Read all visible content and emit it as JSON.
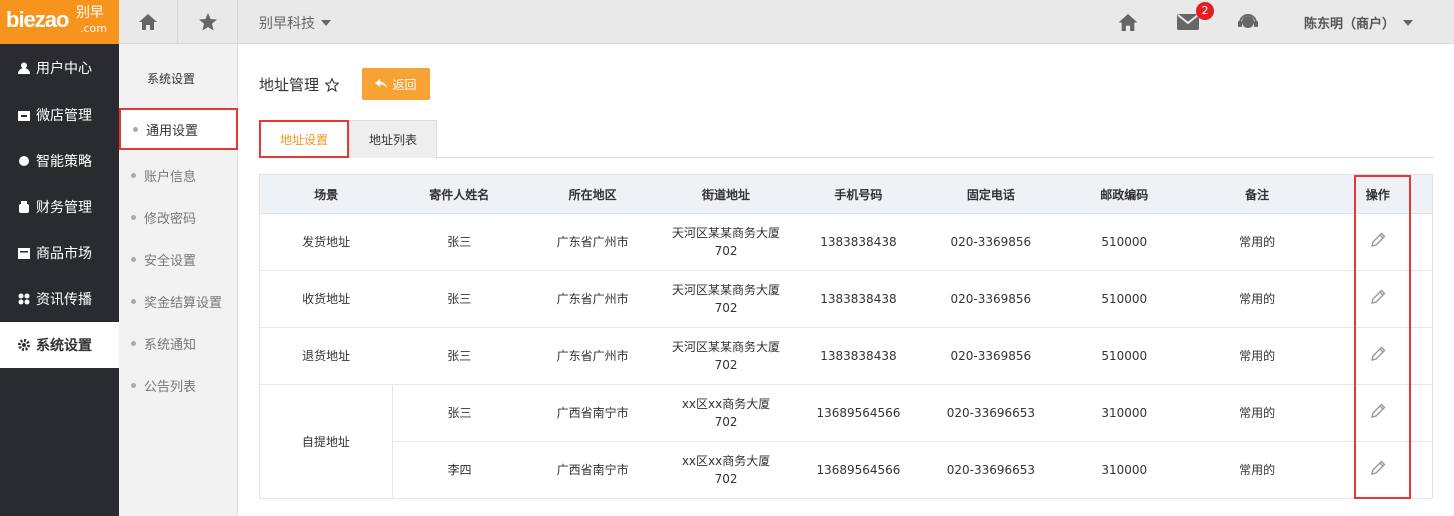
{
  "topbar": {
    "logo_main": "biezao",
    "logo_cn": "别早",
    "logo_domain": ".com",
    "company": "别早科技",
    "unread_count": "2",
    "user": "陈东明（商户）"
  },
  "leftnav": {
    "items": [
      {
        "label": "用户中心",
        "icon": "user-icon"
      },
      {
        "label": "微店管理",
        "icon": "shop-icon"
      },
      {
        "label": "智能策略",
        "icon": "strategy-icon"
      },
      {
        "label": "财务管理",
        "icon": "finance-icon"
      },
      {
        "label": "商品市场",
        "icon": "market-icon"
      },
      {
        "label": "资讯传播",
        "icon": "news-icon"
      },
      {
        "label": "系统设置",
        "icon": "gear-icon"
      }
    ]
  },
  "subnav": {
    "title": "系统设置",
    "items": [
      "通用设置",
      "账户信息",
      "修改密码",
      "安全设置",
      "奖金结算设置",
      "系统通知",
      "公告列表"
    ]
  },
  "main": {
    "title": "地址管理",
    "back_label": "返回",
    "tabs": [
      "地址设置",
      "地址列表"
    ]
  },
  "table": {
    "headers": [
      "场景",
      "寄件人姓名",
      "所在地区",
      "街道地址",
      "手机号码",
      "固定电话",
      "邮政编码",
      "备注",
      "操作"
    ],
    "rows": [
      {
        "scene": "发货地址",
        "name": "张三",
        "region": "广东省广州市",
        "street": "天河区某某商务大厦702",
        "mobile": "1383838438",
        "phone": "020-3369856",
        "zip": "510000",
        "note": "常用的"
      },
      {
        "scene": "收货地址",
        "name": "张三",
        "region": "广东省广州市",
        "street": "天河区某某商务大厦702",
        "mobile": "1383838438",
        "phone": "020-3369856",
        "zip": "510000",
        "note": "常用的"
      },
      {
        "scene": "退货地址",
        "name": "张三",
        "region": "广东省广州市",
        "street": "天河区某某商务大厦702",
        "mobile": "1383838438",
        "phone": "020-3369856",
        "zip": "510000",
        "note": "常用的"
      },
      {
        "scene": "自提地址",
        "name": "张三",
        "region": "广西省南宁市",
        "street": "xx区xx商务大厦702",
        "mobile": "13689564566",
        "phone": "020-33696653",
        "zip": "310000",
        "note": "常用的"
      },
      {
        "scene": "",
        "name": "李四",
        "region": "广西省南宁市",
        "street": "xx区xx商务大厦702",
        "mobile": "13689564566",
        "phone": "020-33696653",
        "zip": "310000",
        "note": "常用的"
      }
    ]
  },
  "colors": {
    "brand": "#f7941d",
    "highlight": "#e53935",
    "nav_bg": "#2a2b2f"
  }
}
